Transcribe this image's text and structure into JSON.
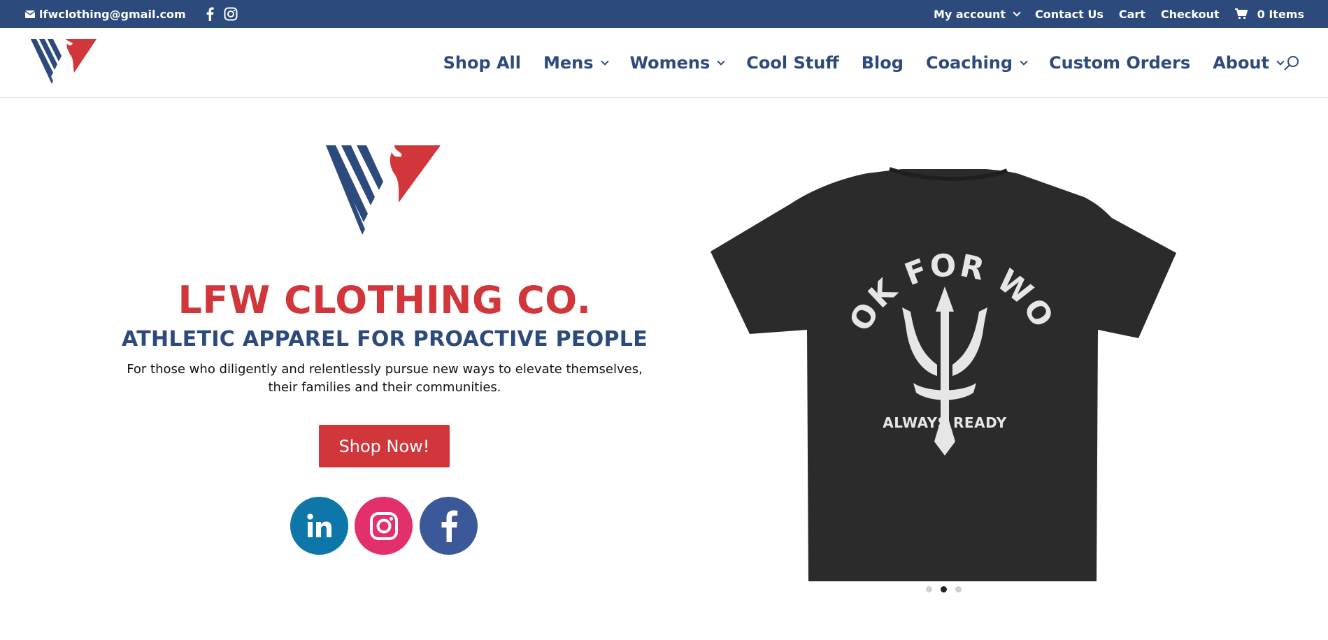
{
  "topbar": {
    "email": "lfwclothing@gmail.com",
    "links": [
      "My account",
      "Contact Us",
      "Cart",
      "Checkout"
    ],
    "cart_items": "0 Items"
  },
  "nav": {
    "items": [
      "Shop All",
      "Mens",
      "Womens",
      "Cool Stuff",
      "Blog",
      "Coaching",
      "Custom Orders",
      "About"
    ]
  },
  "hero": {
    "title": "LFW CLOTHING CO.",
    "tagline": "ATHLETIC APPAREL FOR PROACTIVE PEOPLE",
    "description": "For those who diligently and relentlessly pursue new ways to elevate themselves, their families and their communities.",
    "cta": "Shop Now!"
  },
  "product": {
    "shirt_top_text": "LOOK FOR WORK",
    "shirt_bottom_text": "ALWAYS READY",
    "slides": 3,
    "active_slide": 2
  },
  "colors": {
    "navy": "#2d4a7c",
    "red": "#d1363b",
    "shirt": "#2b2b2b"
  },
  "icons": [
    "email-icon",
    "facebook-icon",
    "instagram-icon",
    "cart-icon",
    "search-icon",
    "linkedin-icon"
  ]
}
